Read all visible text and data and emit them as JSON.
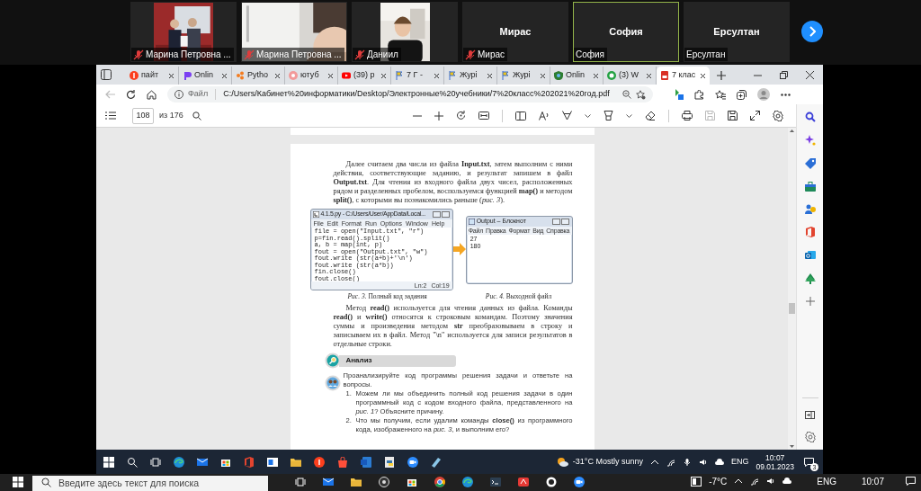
{
  "meeting": {
    "tiles": [
      {
        "kind": "video",
        "label": "Марина Петровна ...",
        "muted": true,
        "speaking": false
      },
      {
        "kind": "video",
        "label": "Марина Петровна ...",
        "muted": true,
        "speaking": false
      },
      {
        "kind": "video",
        "label": "Даниил",
        "muted": true,
        "speaking": false
      },
      {
        "kind": "name",
        "display_name": "Мирас",
        "label": "Мирас",
        "muted": true,
        "speaking": false
      },
      {
        "kind": "name",
        "display_name": "София",
        "label": "София",
        "muted": false,
        "speaking": true
      },
      {
        "kind": "name",
        "display_name": "Ерсултан",
        "label": "Ерсултан",
        "muted": false,
        "speaking": false
      }
    ]
  },
  "browser": {
    "tabs": [
      {
        "label": "пайт",
        "selected": false
      },
      {
        "label": "Onlin",
        "selected": false
      },
      {
        "label": "Pytho",
        "selected": false
      },
      {
        "label": "ютуб",
        "selected": false
      },
      {
        "label": "(39) р",
        "selected": false
      },
      {
        "label": "7 Г -",
        "selected": false
      },
      {
        "label": "Журі",
        "selected": false
      },
      {
        "label": "Журі",
        "selected": false
      },
      {
        "label": "Onlin",
        "selected": false
      },
      {
        "label": "(3) W",
        "selected": false
      },
      {
        "label": "7 клас",
        "selected": true
      }
    ],
    "address": {
      "scheme_label": "Файл",
      "url": "C:/Users/Кабинет%20информатики/Desktop/Электронные%20учебники/7%20класс%202021%20год.pdf"
    },
    "pdf_toolbar": {
      "page": "108",
      "page_count": "из 176"
    },
    "document": {
      "intro": "Далее считаем два числа из файла **Input.txt**, затем выполним с ними действия, соответствующие заданию, и результат запишем в файл **Output.txt**. Для чтения из входного файла двух чисел, расположенных рядом и разделенных пробелом, воспользуемся функцией **map()** и методом **split()**, с которыми вы познакомились раньше (*рис. 3*).",
      "figure_3": {
        "title": "4.1.5.py - C:/Users/User/AppData/Local...",
        "menu": [
          "File",
          "Edit",
          "Format",
          "Run",
          "Options",
          "Window",
          "Help"
        ],
        "code": [
          "file = open(\"Input.txt\", \"r\")",
          "p=fin.read().split()",
          "a, b = map(int, p)",
          "fout = open(\"Output.txt\", \"w\")",
          "fout.write (str(a+b)+'\\n')",
          "fout.write (str(a*b))",
          "fin.close()",
          "fout.close()"
        ],
        "status": [
          "Ln:2",
          "Col:19"
        ],
        "caption": "*Рис. 3.* Полный код задания"
      },
      "figure_4": {
        "title": "Output – Блокнот",
        "menu": [
          "Файл",
          "Правка",
          "Формат",
          "Вид",
          "Справка"
        ],
        "lines": [
          "27",
          "180"
        ],
        "caption": "*Рис. 4.* Выходной файл"
      },
      "paragraph": "Метод **read()** используется для чтения данных из файла. Команды **read()** и **write()** относятся к строковым командам. Поэтому значения суммы и произведения методом **str** преобразовываем в строку и записываем их в файл. Метод \"\\n\" используется для записи результатов в отдельные строки.",
      "section_title": "Анализ",
      "task": "Проанализируйте код программы решения задачи и ответьте на вопросы.",
      "questions": [
        {
          "number": "1.",
          "text": "Можем ли мы объединить полный код решения задачи в один программный код с кодом входного файла, представленного на *рис. 1*? Объясните причину."
        },
        {
          "number": "2.",
          "text": "Что мы получим, если удалим команды **close()** из программного кода, изображенного на *рис. 3*, и выполним его?"
        }
      ]
    }
  },
  "remote_taskbar": {
    "weather": "-31°C Mostly sunny",
    "language": "ENG",
    "time": "10:07",
    "date": "09.01.2023",
    "notifications": "3"
  },
  "local_taskbar": {
    "search_placeholder": "Введите здесь текст для поиска",
    "weather": "-7°C",
    "language": "ENG",
    "time": "10:07"
  }
}
